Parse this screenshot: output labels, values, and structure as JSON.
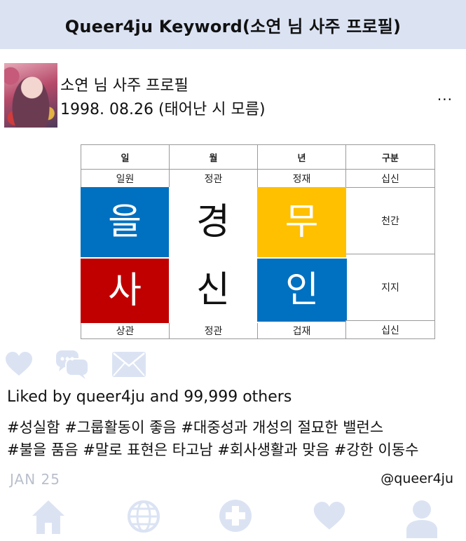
{
  "header": {
    "title": "Queer4ju Keyword(소연 님 사주 프로필)"
  },
  "profile": {
    "name": "소연 님 사주 프로필",
    "birth": "1998. 08.26 (태어난 시 모름)",
    "more_icon": "ellipsis-icon",
    "more_label": "..."
  },
  "saju_table": {
    "headers": [
      "일",
      "월",
      "년",
      "구분"
    ],
    "top_row": [
      "일원",
      "정관",
      "정재",
      "십신"
    ],
    "cheongan": [
      "을",
      "경",
      "무"
    ],
    "jiji": [
      "사",
      "신",
      "인"
    ],
    "row_labels": [
      "천간",
      "지지"
    ],
    "bottom_row": [
      "상관",
      "정관",
      "겁재",
      "십신"
    ],
    "colors": {
      "eul": "#0070c0",
      "gyeong": "#ffffff",
      "mu": "#ffc000",
      "sa": "#c00000",
      "sin": "#ffffff",
      "in": "#0070c0"
    }
  },
  "actions": {
    "icons": [
      "heart-icon",
      "comment-icon",
      "mail-icon"
    ],
    "color": "#dbe3f3"
  },
  "post": {
    "likes": "Liked by queer4ju and 99,999 others",
    "tags_line1": "#성실함 #그룹활동이 좋음 #대중성과 개성의 절묘한 밸런스",
    "tags_line2": "#불을 품음 #말로 표현은 타고남 #회사생활과 맞음 #강한 이동수",
    "date": "JAN 25",
    "handle": "@queer4ju"
  },
  "bottom_nav": {
    "icons": [
      "home-icon",
      "globe-icon",
      "add-icon",
      "heart-icon",
      "profile-icon"
    ],
    "color": "#dbe3f3"
  }
}
